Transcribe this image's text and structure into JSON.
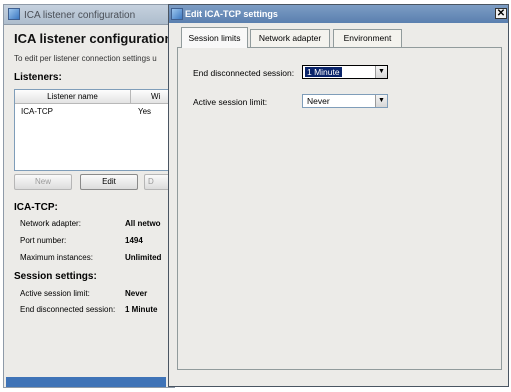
{
  "back_window": {
    "title": "ICA listener configuration",
    "heading": "ICA listener configuration",
    "description": "To edit per listener connection settings u",
    "listeners_label": "Listeners:",
    "columns": [
      "Listener name",
      "Wi"
    ],
    "rows": [
      {
        "name": "ICA-TCP",
        "value": "Yes"
      }
    ],
    "buttons": {
      "new": "New",
      "edit": "Edit",
      "delete": "D"
    },
    "listener_section": "ICA-TCP:",
    "listener_props": [
      {
        "label": "Network adapter:",
        "value": "All netwo"
      },
      {
        "label": "Port number:",
        "value": "1494"
      },
      {
        "label": "Maximum instances:",
        "value": "Unlimited"
      }
    ],
    "session_section": "Session settings:",
    "session_props": [
      {
        "label": "Active session limit:",
        "value": "Never"
      },
      {
        "label": "End disconnected session:",
        "value": "1 Minute"
      }
    ]
  },
  "dialog": {
    "title": "Edit ICA-TCP settings",
    "close_symbol": "✕",
    "tabs": [
      "Session limits",
      "Network adapter",
      "Environment"
    ],
    "active_tab": "Session limits",
    "fields": {
      "end_disconnected": {
        "label": "End disconnected session:",
        "value": "1 Minute"
      },
      "active_limit": {
        "label": "Active session limit:",
        "value": "Never"
      }
    }
  },
  "icons": {
    "window_icon": "app-window-icon",
    "dropdown": "chevron-down-icon"
  },
  "colors": {
    "dialog_title_bar": "#5a7faf",
    "selection_highlight": "#0a246a",
    "window_face": "#ecebe8"
  }
}
